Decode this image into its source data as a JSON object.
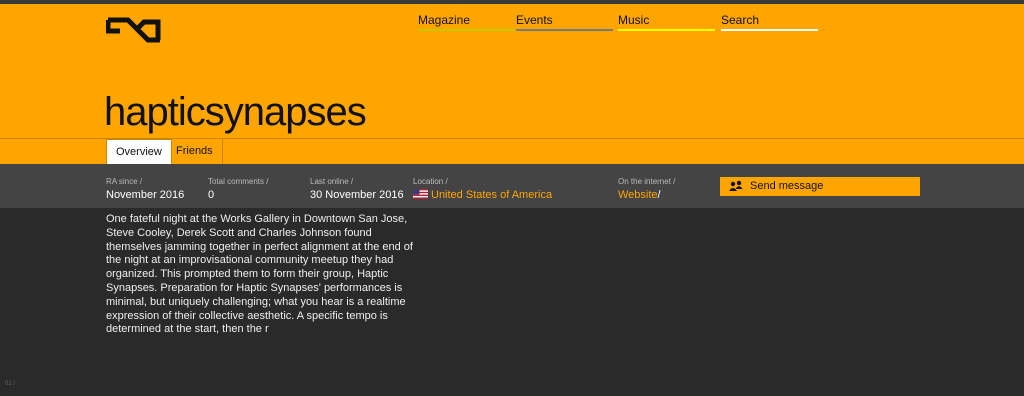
{
  "nav": {
    "items": [
      {
        "label": "Magazine",
        "color": "#c8c800"
      },
      {
        "label": "Events",
        "color": "#7a7a7a"
      },
      {
        "label": "Music",
        "color": "#ffff00"
      },
      {
        "label": "Search",
        "color": "#ffffff"
      }
    ]
  },
  "profile": {
    "name": "hapticsynapses"
  },
  "tabs": [
    {
      "label": "Overview",
      "active": true
    },
    {
      "label": "Friends",
      "active": false
    }
  ],
  "stats": {
    "ra_since": {
      "label": "RA since /",
      "value": "November 2016"
    },
    "total_comments": {
      "label": "Total comments /",
      "value": "0"
    },
    "last_online": {
      "label": "Last online /",
      "value": "30 November 2016"
    },
    "location": {
      "label": "Location /",
      "value": "United States of America",
      "flag_icon": "us-flag-icon"
    },
    "on_internet": {
      "label": "On the internet /",
      "value": "Website",
      "suffix": "/"
    }
  },
  "actions": {
    "send_message": "Send message",
    "send_icon": "user-message-icon"
  },
  "bio": "One fateful night at the Works Gallery in Downtown San Jose, Steve Cooley, Derek Scott and Charles Johnson found themselves jamming together in perfect alignment at the end of the night at an improvisational community meetup they had organized. This prompted them to form their group, Haptic Synapses. Preparation for Haptic Synapses' performances is minimal, but uniquely challenging; what you hear is a realtime expression of their collective aesthetic. A specific tempo is determined at the start, then the r",
  "pager": "01 /",
  "colors": {
    "accent": "#ffa500",
    "dark": "#2a2a2a",
    "statbar": "#444444"
  }
}
